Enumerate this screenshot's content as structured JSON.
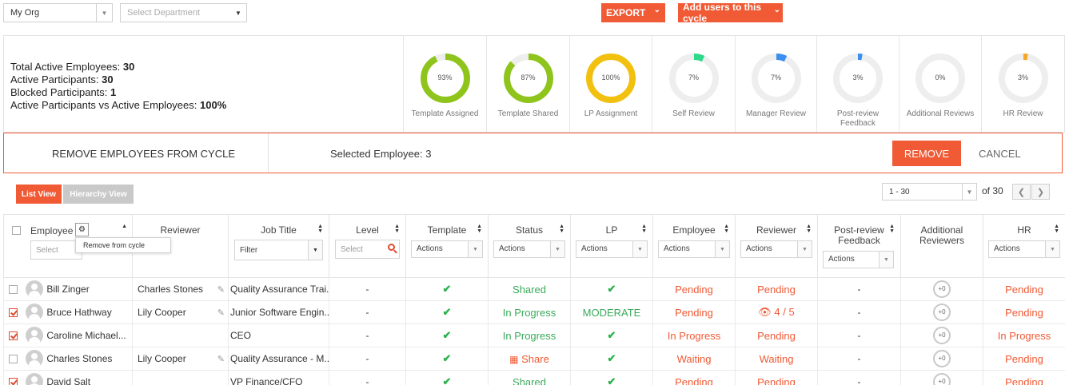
{
  "topbar": {
    "org_select": "My Org",
    "dept_placeholder": "Select Department",
    "export_label": "EXPORT",
    "add_users_label": "Add users to this cycle"
  },
  "stats": {
    "lines": [
      {
        "label": "Total Active Employees:",
        "value": "30"
      },
      {
        "label": "Active Participants:",
        "value": "30"
      },
      {
        "label": "Blocked Participants:",
        "value": "1"
      },
      {
        "label": "Active Participants vs Active Employees:",
        "value": "100%"
      }
    ],
    "gauges": [
      {
        "label": "Template Assigned",
        "pct_text": "93%",
        "pct": 93,
        "color": "#8fc41c"
      },
      {
        "label": "Template Shared",
        "pct_text": "87%",
        "pct": 87,
        "color": "#8fc41c"
      },
      {
        "label": "LP Assignment",
        "pct_text": "100%",
        "pct": 100,
        "color": "#f2c10f"
      },
      {
        "label": "Self Review",
        "pct_text": "7%",
        "pct": 7,
        "color": "#2fd98c"
      },
      {
        "label": "Manager Review",
        "pct_text": "7%",
        "pct": 7,
        "color": "#3a8ff0"
      },
      {
        "label": "Post-review Feedback",
        "pct_text": "3%",
        "pct": 3,
        "color": "#3a8ff0"
      },
      {
        "label": "Additional Reviews",
        "pct_text": "0%",
        "pct": 0,
        "color": "#cccccc"
      },
      {
        "label": "HR Review",
        "pct_text": "3%",
        "pct": 3,
        "color": "#f5a623"
      }
    ]
  },
  "remove_bar": {
    "title": "REMOVE EMPLOYEES FROM CYCLE",
    "selected_text": "Selected Employee: 3",
    "remove_label": "REMOVE",
    "cancel_label": "CANCEL"
  },
  "view": {
    "list_label": "List View",
    "hierarchy_label": "Hierarchy View"
  },
  "pager": {
    "range": "1 - 30",
    "of_text": "of 30"
  },
  "columns": {
    "employee": "Employee",
    "employee_placeholder": "Select",
    "reviewer": "Reviewer",
    "job_title": "Job Title",
    "job_filter": "Filter",
    "level": "Level",
    "level_placeholder": "Select",
    "template": "Template",
    "status": "Status",
    "lp": "LP",
    "employee_review": "Employee",
    "reviewer_review": "Reviewer",
    "post_review": "Post-review Feedback",
    "additional": "Additional Reviewers",
    "hr": "HR",
    "actions": "Actions"
  },
  "tooltip": "Remove from cycle",
  "rows": [
    {
      "checked": false,
      "name": "Bill Zinger",
      "reviewer": "Charles Stones",
      "job": "Quality Assurance Trai...",
      "level": "-",
      "status": "Shared",
      "lp": "check",
      "emp": "Pending",
      "rev": "Pending",
      "post": "-",
      "add": "+0",
      "hr": "Pending"
    },
    {
      "checked": true,
      "name": "Bruce Hathway",
      "reviewer": "Lily Cooper",
      "job": "Junior Software Engin...",
      "level": "-",
      "status": "In Progress",
      "lp": "MODERATE",
      "emp": "Pending",
      "rev": "4 / 5",
      "post": "-",
      "add": "+0",
      "hr": "Pending"
    },
    {
      "checked": true,
      "name": "Caroline Michael...",
      "reviewer": "",
      "job": "CEO",
      "level": "-",
      "status": "In Progress",
      "lp": "check",
      "emp": "In Progress",
      "rev": "Pending",
      "post": "-",
      "add": "+0",
      "hr": "In Progress"
    },
    {
      "checked": false,
      "name": "Charles Stones",
      "reviewer": "Lily Cooper",
      "job": "Quality Assurance - M...",
      "level": "-",
      "status": "Share",
      "lp": "check",
      "emp": "Waiting",
      "rev": "Waiting",
      "post": "-",
      "add": "+0",
      "hr": "Pending"
    },
    {
      "checked": true,
      "name": "David Salt",
      "reviewer": "",
      "job": "VP Finance/CFO",
      "level": "-",
      "status": "Shared",
      "lp": "check",
      "emp": "Pending",
      "rev": "Pending",
      "post": "-",
      "add": "+0",
      "hr": "Pending"
    }
  ]
}
